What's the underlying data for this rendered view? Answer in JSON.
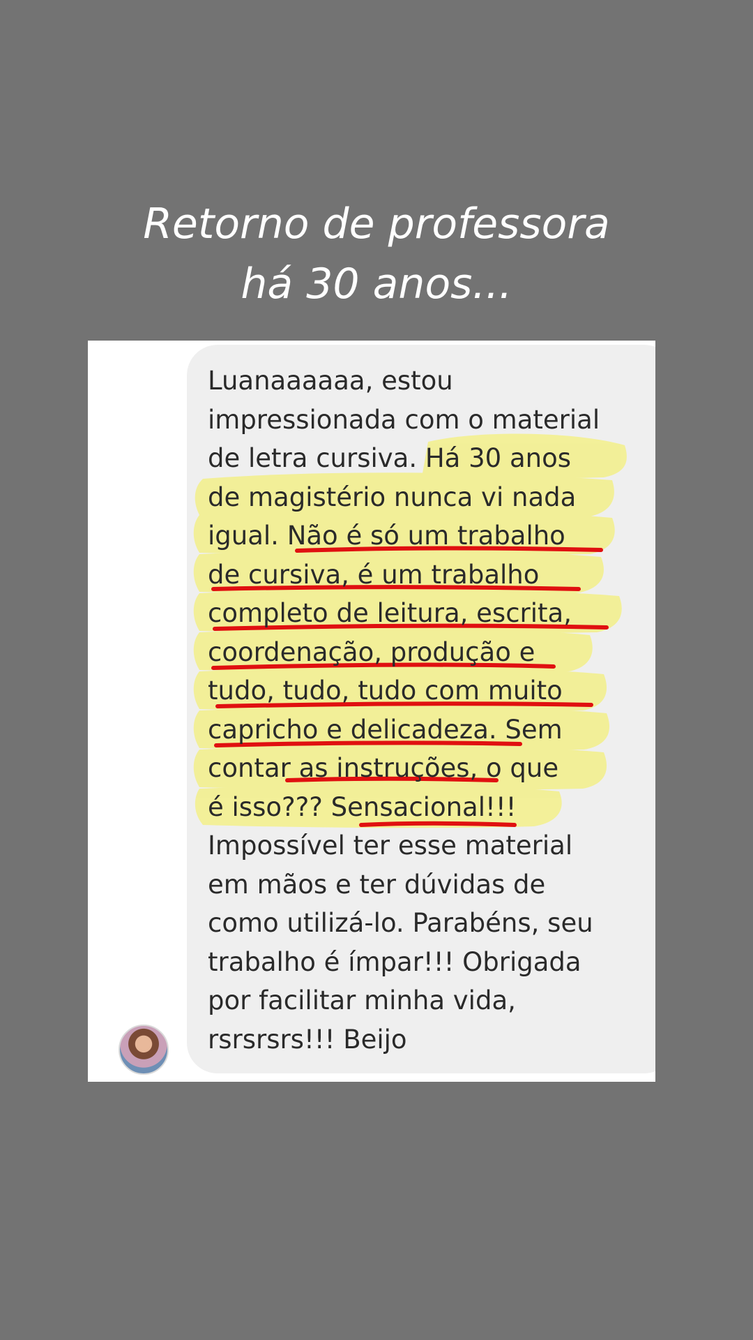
{
  "header": {
    "title_line1": "Retorno de professora",
    "title_line2": "há 30 anos..."
  },
  "chat": {
    "message_lines": [
      "Luanaaaaaa, estou",
      "impressionada com o material",
      "de letra cursiva. Há 30 anos",
      "de magistério nunca vi nada",
      "igual. Não é só um trabalho",
      "de cursiva, é um trabalho",
      "completo de leitura, escrita,",
      "coordenação, produção e",
      "tudo, tudo, tudo com muito",
      "capricho e delicadeza. Sem",
      "contar as instruções, o que",
      "é isso??? Sensacional!!!",
      "Impossível ter esse material",
      "em mãos e ter dúvidas de",
      "como utilizá-lo. Parabéns, seu",
      "trabalho é ímpar!!! Obrigada",
      "por facilitar minha vida,",
      "rsrsrsrs!!! Beijo"
    ]
  },
  "colors": {
    "page_background": "#737373",
    "highlight": "#f3f08a",
    "underline": "#e01010"
  }
}
